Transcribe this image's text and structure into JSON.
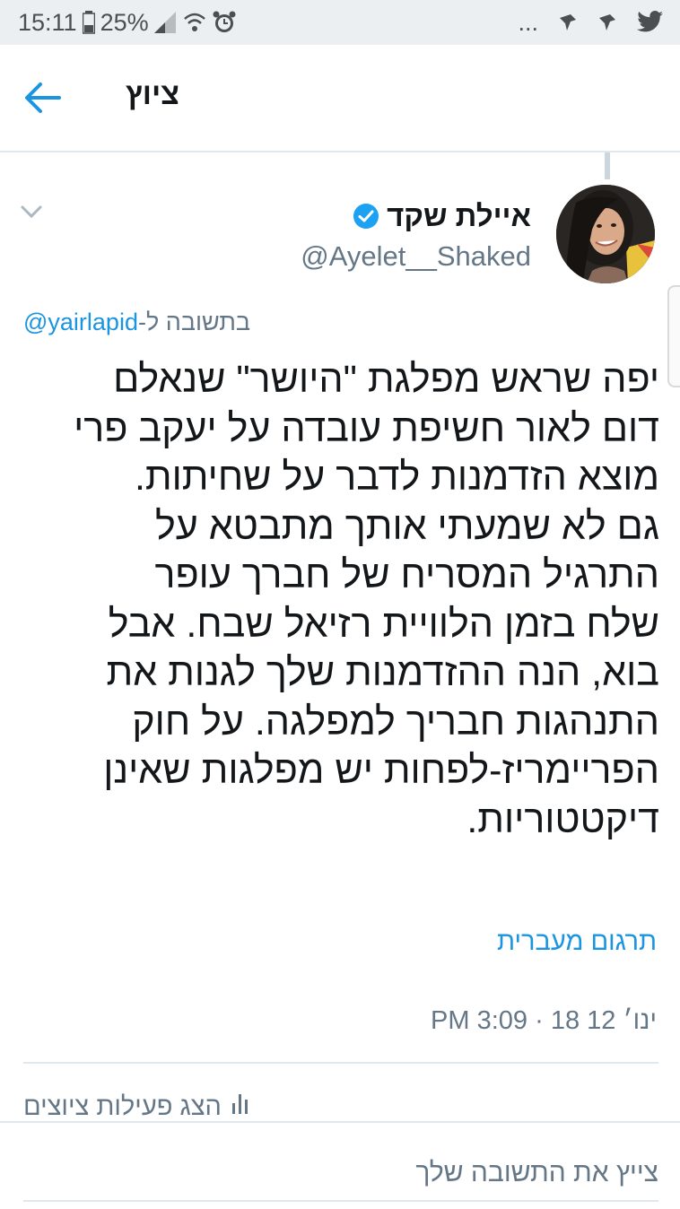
{
  "status_bar": {
    "time": "15:11",
    "battery": "25%",
    "icons": [
      "battery-icon",
      "signal-icon",
      "wifi-icon",
      "alarm-icon",
      "more-dots-icon",
      "notification-icon",
      "notification-icon",
      "twitter-bird-icon"
    ],
    "more": "..."
  },
  "header": {
    "title": "ציוץ",
    "back_icon": "arrow-left-icon"
  },
  "tweet": {
    "author_name": "איילת שקד",
    "handle": "@Ayelet__Shaked",
    "verified": true,
    "reply_prefix": "בתשובה ל-",
    "reply_to": "@yairlapid",
    "lines": [
      "יפה שראש מפלגת \"היושר\" שנאלם",
      "דום לאור חשיפת עובדה על יעקב פרי",
      "מוצא הזדמנות לדבר על שחיתות.",
      "גם לא שמעתי אותך מתבטא על",
      "התרגיל המסריח של חברך עופר",
      "שלח בזמן הלוויית רזיאל שבח. אבל",
      "בוא, הנה ההזדמנות שלך לגנות את",
      "התנהגות חבריך למפלגה. על חוק",
      "הפריימריז-לפחות יש מפלגות שאינן",
      "דיקטטוריות."
    ],
    "translate_label": "תרגום מעברית",
    "timestamp": "ינו׳ 12 18 · 3:09 PM",
    "activity_label": "הצג פעילות ציוצים"
  },
  "reply": {
    "placeholder": "צייץ את התשובה שלך"
  },
  "colors": {
    "accent": "#1b95e0",
    "secondary_text": "#657786",
    "status_bar_bg": "#eceff1"
  }
}
